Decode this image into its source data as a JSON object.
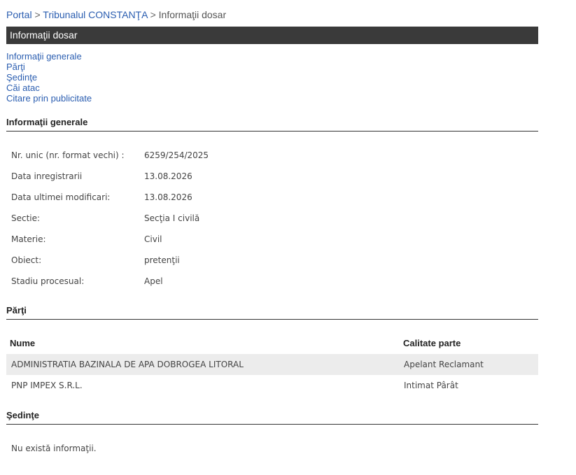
{
  "breadcrumb": {
    "portal": "Portal",
    "sep1": ">",
    "court": "Tribunalul CONSTANŢA",
    "sep2": ">",
    "current": "Informaţii dosar"
  },
  "header": {
    "title": "Informaţii dosar"
  },
  "toc": {
    "items": [
      {
        "label": "Informaţii generale"
      },
      {
        "label": "Părţi"
      },
      {
        "label": "Şedinţe"
      },
      {
        "label": "Căi atac"
      },
      {
        "label": "Citare prin publicitate"
      }
    ]
  },
  "general": {
    "title": "Informaţii generale",
    "rows": [
      {
        "label": "Nr. unic (nr. format vechi) :",
        "value": "6259/254/2025"
      },
      {
        "label": "Data inregistrarii",
        "value": "13.08.2026"
      },
      {
        "label": "Data ultimei modificari:",
        "value": "13.08.2026"
      },
      {
        "label": "Sectie:",
        "value": "Secţia I civilă"
      },
      {
        "label": "Materie:",
        "value": "Civil"
      },
      {
        "label": "Obiect:",
        "value": "pretenţii"
      },
      {
        "label": "Stadiu procesual:",
        "value": "Apel"
      }
    ]
  },
  "parties": {
    "title": "Părţi",
    "headers": {
      "name": "Nume",
      "role": "Calitate parte"
    },
    "rows": [
      {
        "name": "ADMINISTRATIA BAZINALA DE APA DOBROGEA LITORAL",
        "role": "Apelant Reclamant"
      },
      {
        "name": "PNP IMPEX S.R.L.",
        "role": "Intimat Pârât"
      }
    ]
  },
  "hearings": {
    "title": "Şedinţe",
    "empty": "Nu există informaţii."
  },
  "colors": {
    "link": "#2a5db0",
    "header_bar": "#3a3a3a",
    "row_alt": "#ececec"
  }
}
